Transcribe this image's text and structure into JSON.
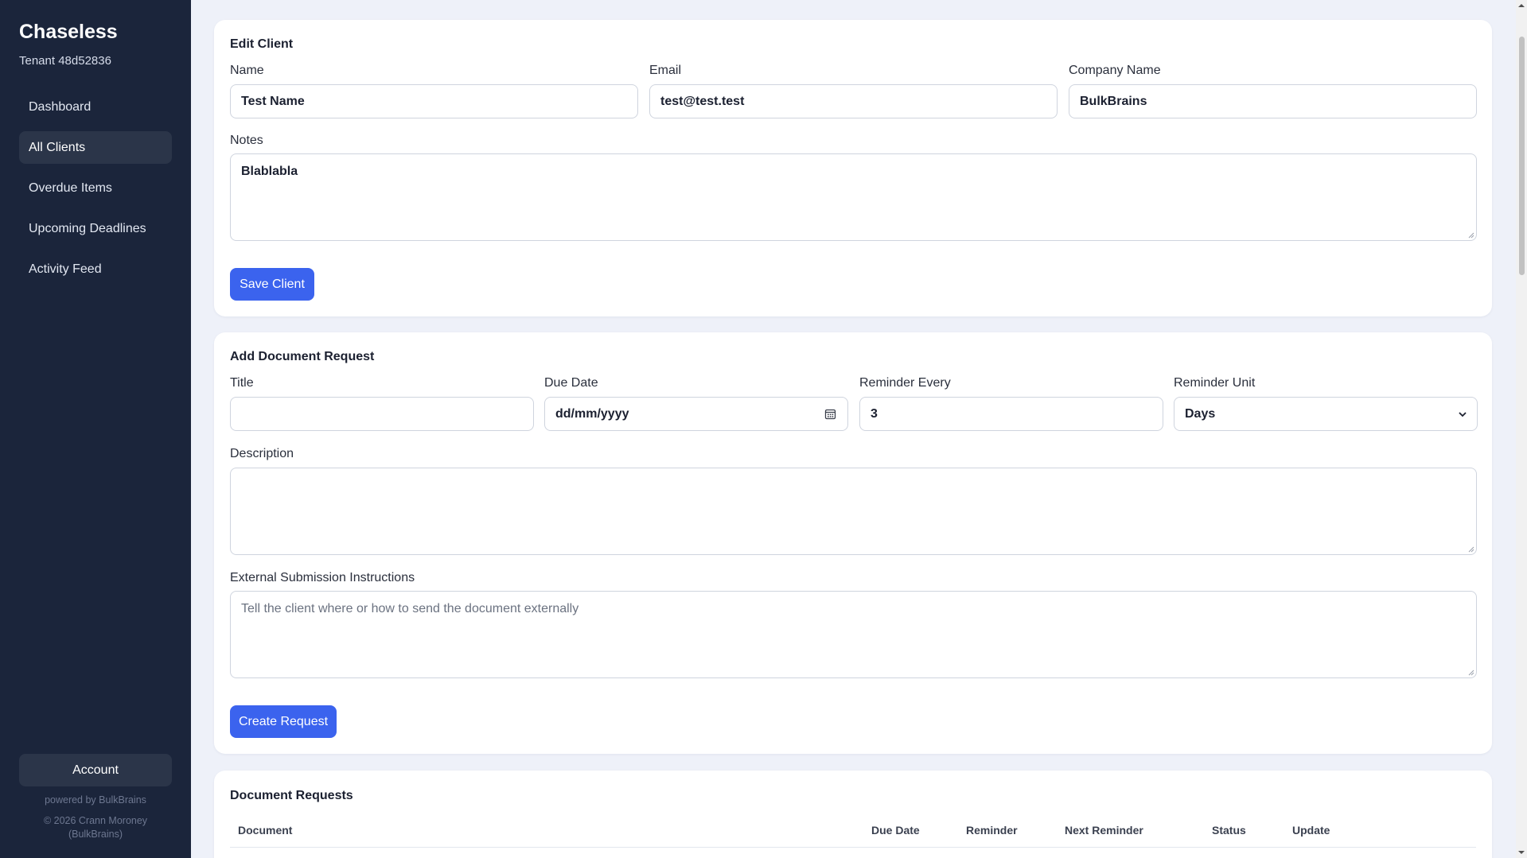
{
  "sidebar": {
    "brand": "Chaseless",
    "tenant": "Tenant 48d52836",
    "items": [
      {
        "label": "Dashboard"
      },
      {
        "label": "All Clients",
        "active": true
      },
      {
        "label": "Overdue Items"
      },
      {
        "label": "Upcoming Deadlines"
      },
      {
        "label": "Activity Feed"
      }
    ],
    "account_label": "Account",
    "powered_by": "powered by BulkBrains",
    "copyright": "© 2026 Crann Moroney (BulkBrains)"
  },
  "edit_client": {
    "title": "Edit Client",
    "name_label": "Name",
    "name_value": "Test Name",
    "email_label": "Email",
    "email_value": "test@test.test",
    "company_label": "Company Name",
    "company_value": "BulkBrains",
    "notes_label": "Notes",
    "notes_value": "Blablabla",
    "save_label": "Save Client"
  },
  "add_request": {
    "title": "Add Document Request",
    "title_label": "Title",
    "title_value": "",
    "due_label": "Due Date",
    "due_value": "dd/mm/yyyy",
    "reminder_label": "Reminder Every",
    "reminder_value": "3",
    "unit_label": "Reminder Unit",
    "unit_value": "Days",
    "description_label": "Description",
    "description_value": "",
    "external_label": "External Submission Instructions",
    "external_placeholder": "Tell the client where or how to send the document externally",
    "create_label": "Create Request"
  },
  "document_requests": {
    "title": "Document Requests",
    "columns": [
      "Document",
      "Due Date",
      "Reminder",
      "Next Reminder",
      "Status",
      "Update"
    ]
  },
  "colors": {
    "sidebar_bg": "#1b253b",
    "accent": "#3b63ee",
    "page_bg": "#eef1f9"
  }
}
